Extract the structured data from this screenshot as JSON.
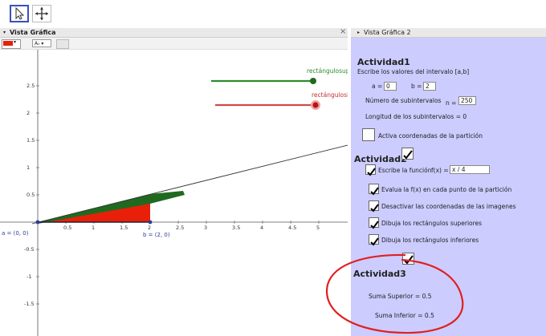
{
  "toolbar": {
    "move_icon": "cursor-arrow-icon",
    "pan_icon": "move-graphics-icon"
  },
  "graphics_view": {
    "title": "Vista Gráfica",
    "close_glyph": "×",
    "font_size_label": "A₀ ▾",
    "x_ticks": [
      "0.5",
      "1",
      "1.5",
      "2",
      "2.5",
      "3",
      "3.5",
      "4",
      "4.5",
      "5"
    ],
    "y_ticks": [
      "2.5",
      "2",
      "1.5",
      "1",
      "0.5",
      "-0.5",
      "-1",
      "-1.5"
    ],
    "point_a_label": "a = (0, 0)",
    "point_b_label": "b = (2, 0)",
    "slider_sup_label": "rectángulosup",
    "slider_inf_label": "rectángulosin",
    "slider_sup_color": "#2e8b2e",
    "slider_inf_color": "#d24a4a",
    "fill_color": "#e8200a",
    "accent_color": "#1f6a1f"
  },
  "panel": {
    "title": "Vista Gráfica 2",
    "bg_color": "#ccccff",
    "actividad1": {
      "title": "Actividad1",
      "instruction": "Escribe los valores del intervalo [a,b]",
      "a_label": "a =",
      "a_value": "0",
      "b_label": "b =",
      "b_value": "2",
      "n_label": "Número de subintervalos",
      "n_symbol": "n =",
      "n_value": "250",
      "length_text": "Longitud de los subintervalos = 0",
      "partition_label": "Activa coordenadas de la partición"
    },
    "actividad2": {
      "title": "Actividad2",
      "func_label": "Escribe la función",
      "func_symbol": "f(x) =",
      "func_value": "x / 4",
      "items": [
        "Evalua la f(x) en cada punto de la partición",
        "Desactivar las coordenadas de las imagenes",
        "Dibuja los rectángulos superiores",
        "Dibuja los rectángulos inferiores"
      ]
    },
    "actividad3": {
      "title": "Actividad3",
      "suma_superior": "Suma Superior = 0.5",
      "suma_inferior": "Suma Inferior = 0.5",
      "annotation_color": "#e02020"
    }
  }
}
